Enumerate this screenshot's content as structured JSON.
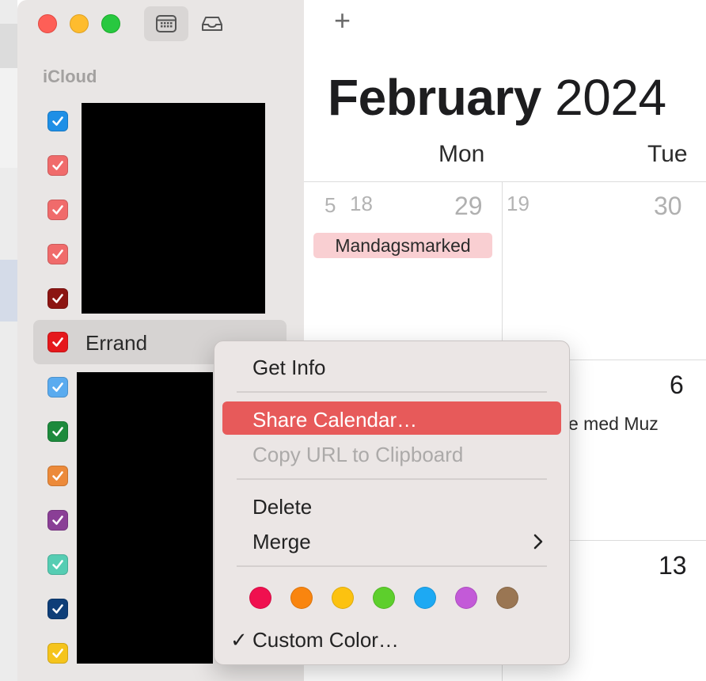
{
  "sidebar": {
    "section_title": "iCloud",
    "calendars": [
      {
        "color": "#1e8fe6"
      },
      {
        "color": "#f06b6b"
      },
      {
        "color": "#f06b6b"
      },
      {
        "color": "#f06b6b"
      },
      {
        "color": "#8c1512"
      },
      {
        "label": "Errand",
        "color": "#e5181c"
      },
      {
        "color": "#5aabef"
      },
      {
        "color": "#1d8a3c"
      },
      {
        "color": "#ec8a3a"
      },
      {
        "color": "#8a3f96"
      },
      {
        "color": "#56cdb3"
      },
      {
        "color": "#0e3e78"
      },
      {
        "color": "#f5c41c"
      }
    ]
  },
  "toolbar": {
    "calendar_icon": "calendar-icon",
    "inbox_icon": "inbox-icon",
    "add_label": "+"
  },
  "calendar": {
    "month": "February",
    "year": "2024",
    "weekdays": [
      "Mon",
      "Tue"
    ],
    "rows": [
      {
        "week_before": "5",
        "mon_week": "18",
        "mon_day": "29",
        "tue_week": "19",
        "tue_day": "30"
      },
      {
        "tue_day": "6"
      },
      {
        "tue_day": "13"
      }
    ],
    "events": {
      "monday_event": "Mandagsmarked",
      "partial_event": "e med Muz"
    }
  },
  "context_menu": {
    "items": {
      "get_info": "Get Info",
      "share_calendar": "Share Calendar…",
      "copy_url": "Copy URL to Clipboard",
      "delete": "Delete",
      "merge": "Merge",
      "custom_color": "Custom Color…"
    },
    "checkmark": "✓",
    "colors": [
      "#f0104f",
      "#f9850f",
      "#fcc210",
      "#5dcf2c",
      "#1da9f3",
      "#c35ad8",
      "#9a7653"
    ]
  }
}
